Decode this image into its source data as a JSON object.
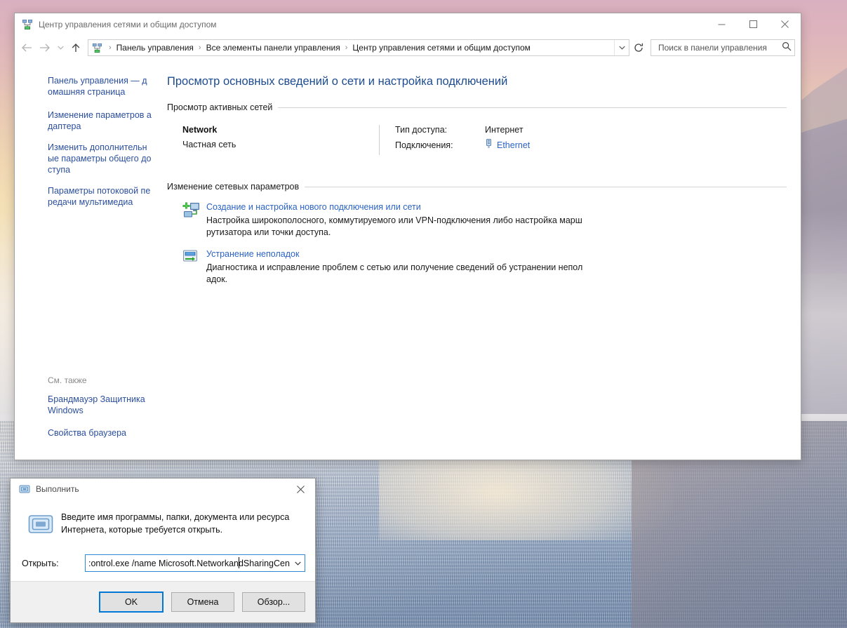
{
  "window": {
    "title": "Центр управления сетями и общим доступом",
    "title_icon": "network-sharing-icon",
    "controls": {
      "minimize": "minimize-icon",
      "maximize": "maximize-icon",
      "close": "close-icon"
    }
  },
  "nav": {
    "back": "back-arrow-icon",
    "forward": "forward-arrow-icon",
    "recent": "chevron-down-icon",
    "up": "up-arrow-icon",
    "refresh": "refresh-icon",
    "address_dropdown": "chevron-down-icon",
    "breadcrumbs": [
      "Панель управления",
      "Все элементы панели управления",
      "Центр управления сетями и общим доступом"
    ],
    "separator": "›"
  },
  "search": {
    "placeholder": "Поиск в панели управления",
    "value": "",
    "icon": "search-icon"
  },
  "sidebar": {
    "links": [
      "Панель управления — домашняя страница",
      "Изменение параметров адаптера",
      "Изменить дополнительные параметры общего доступа",
      "Параметры потоковой передачи мультимедиа"
    ],
    "see_also_heading": "См. также",
    "see_also_links": [
      "Брандмауэр Защитника Windows",
      "Свойства браузера"
    ]
  },
  "main": {
    "heading": "Просмотр основных сведений о сети и настройка подключений",
    "active_networks": {
      "section_title": "Просмотр активных сетей",
      "network_name": "Network",
      "network_type": "Частная сеть",
      "rows": [
        {
          "label": "Тип доступа:",
          "value": "Интернет",
          "link": ""
        },
        {
          "label": "Подключения:",
          "value": "",
          "link": "Ethernet",
          "icon": "ethernet-adapter-icon"
        }
      ]
    },
    "change_settings": {
      "section_title": "Изменение сетевых параметров",
      "tasks": [
        {
          "icon": "new-connection-icon",
          "title": "Создание и настройка нового подключения или сети",
          "description": "Настройка широкополосного, коммутируемого или VPN-подключения либо настройка маршрутизатора или точки доступа."
        },
        {
          "icon": "troubleshoot-icon",
          "title": "Устранение неполадок",
          "description": "Диагностика и исправление проблем с сетью или получение сведений об устранении неполадок."
        }
      ]
    }
  },
  "run_dialog": {
    "title": "Выполнить",
    "title_icon": "run-small-icon",
    "close_icon": "close-icon",
    "big_icon": "run-large-icon",
    "prompt": "Введите имя программы, папки, документа или ресурса Интернета, которые требуется открыть.",
    "open_label": "Открыть:",
    "input_value": ":ontrol.exe /name Microsoft.NetworkandSharingCenter",
    "combo_arrow": "chevron-down-icon",
    "buttons": {
      "ok": "OK",
      "cancel": "Отмена",
      "browse": "Обзор..."
    }
  },
  "colors": {
    "link": "#2b63c4",
    "sidebar_link": "#2b4f9e",
    "heading": "#1d4b8f",
    "accent": "#0078d7"
  }
}
